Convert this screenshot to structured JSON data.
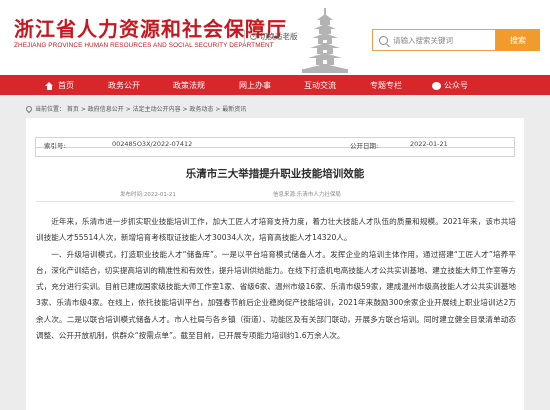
{
  "header": {
    "title": "浙江省人力资源和社会保障厅",
    "subtitle": "ZHEJIANG PROVINCE HUMAN RESOURCES AND SOCIAL SECURITY DEPARTMENT",
    "old_mode": "切换适老版",
    "search": {
      "placeholder": "请输入搜索关键词",
      "button": "搜索"
    }
  },
  "nav": {
    "items": [
      "首页",
      "政务公开",
      "政策法规",
      "网上办事",
      "互动交流",
      "专题专栏",
      "公众号"
    ]
  },
  "breadcrumb": "当前位置： 首页 > 政府信息公开 > 法定主动公开内容 > 政务动态 > 最新资讯",
  "meta": {
    "index_label": "索引号:",
    "index_value": "002485O3X/2022-07412",
    "date_label": "公开日期:",
    "date_value": "2022-01-21"
  },
  "article": {
    "title": "乐清市三大举措提升职业技能培训效能",
    "published": "发布时间:2022-01-21",
    "source": "信息来源:乐清市人力社保局",
    "paragraphs": [
      "近年来，乐清市进一步抓实职业技能培训工作，加大工匠人才培育支持力度，着力壮大技能人才队伍的质量和规模。2021年来，该市共培训技能人才55514人次，新增培育考核取证技能人才30034人次，培育高技能人才14320人。",
      "一、升级培训模式，打造职业技能人才“储备库”。一是以平台培育模式储备人才。发挥企业的培训主体作用，通过搭建“工匠人才”培养平台，深化产训结合，切实提高培训的精准性和有效性，提升培训供给能力。在线下打造机电高技能人才公共实训基地、建立技能大师工作室等方式，充分进行实训。目前已建成国家级技能大师工作室1家、省级6家、温州市级16家、乐清市级59家，建成温州市级高技能人才公共实训基地3家、乐清市级4家。在线上，依托技能培训平台，加强春节前后企业稳岗促产技能培训，2021年来鼓励300余家企业开展线上职业培训达2万余人次。二是以联合培训模式储备人才。市人社局与各乡镇（街道）、功能区及有关部门联动，开展多方联合培训。同时建立健全目录清单动态调整、公开开放机制，供群众“按需点单”。截至目前，已开展专项能力培训约1.6万余人次。"
    ]
  }
}
